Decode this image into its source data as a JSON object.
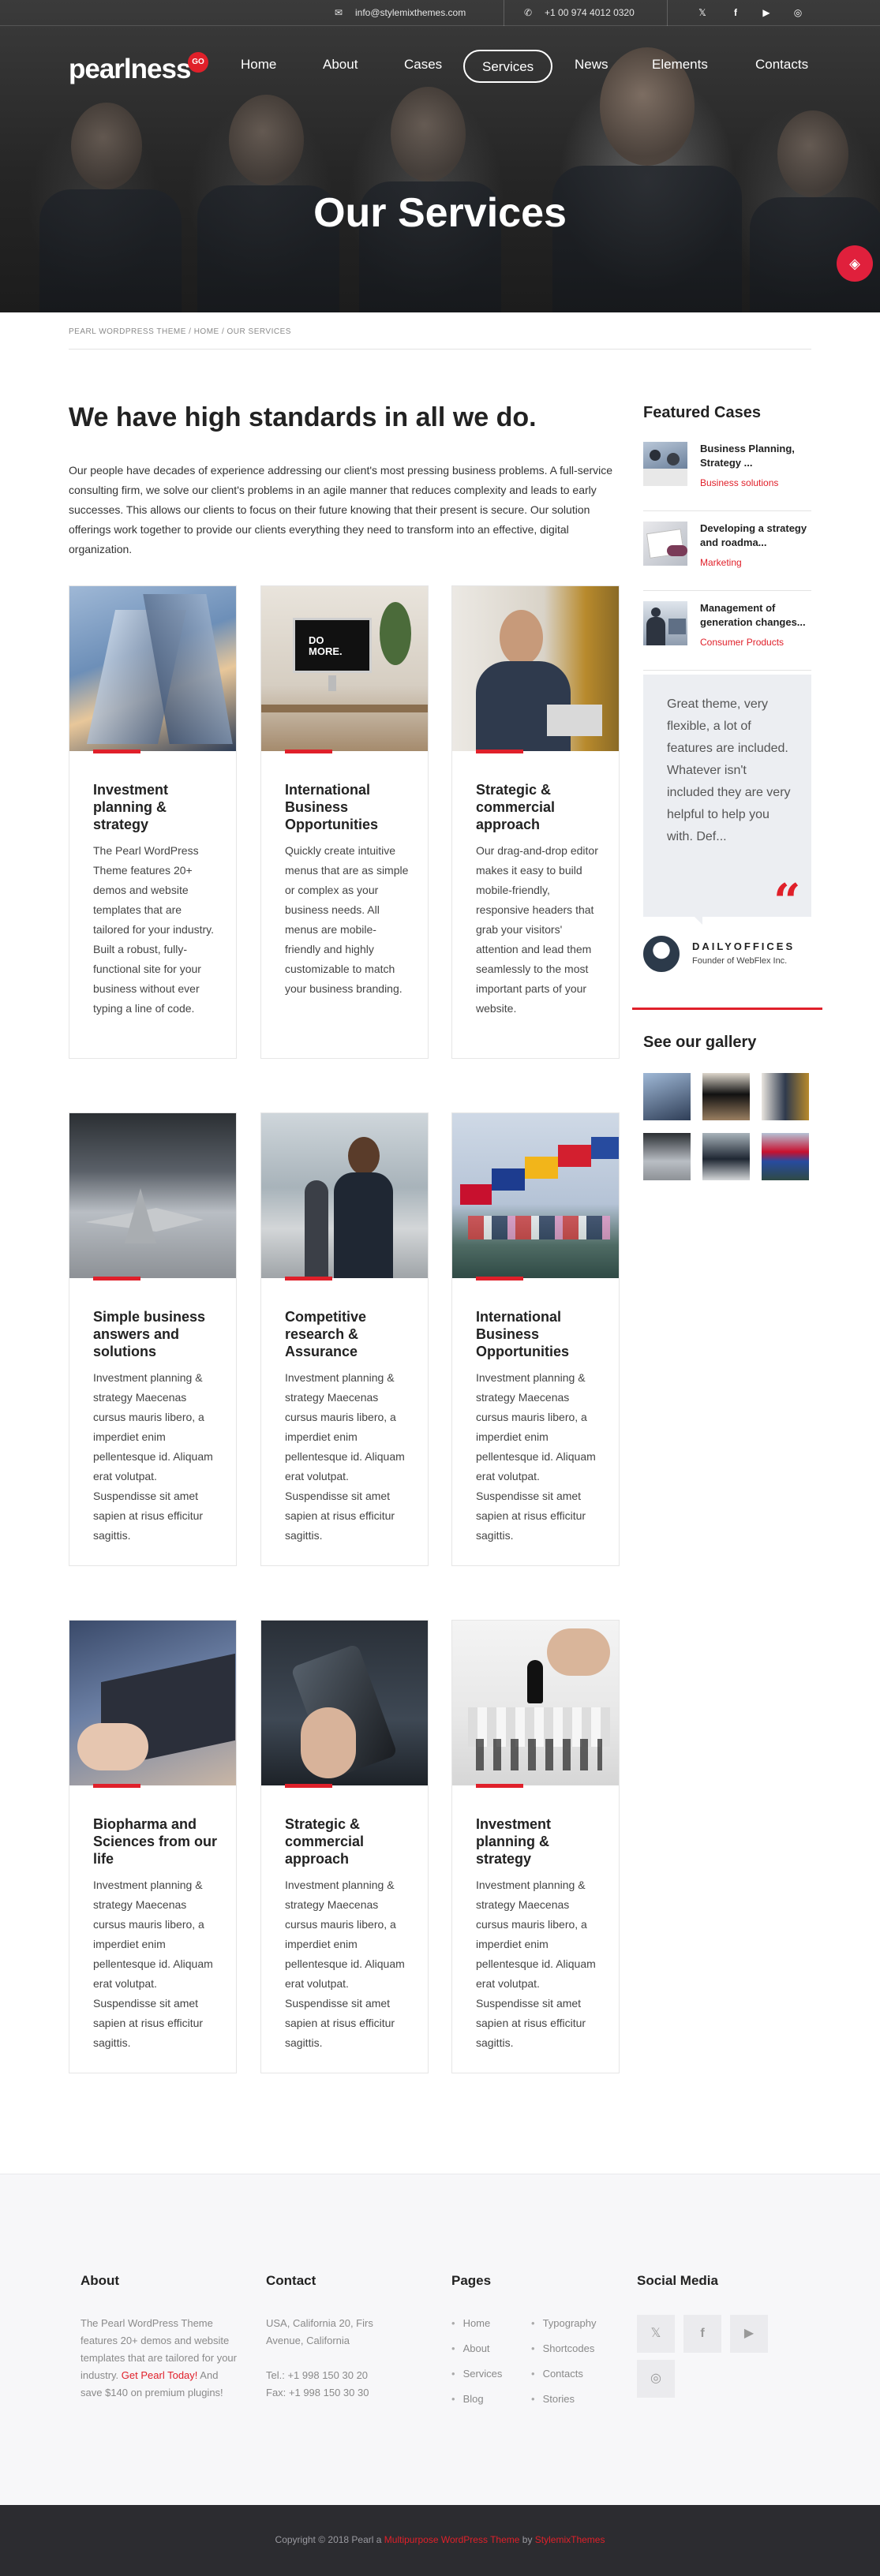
{
  "topbar": {
    "email": "info@stylemixthemes.com",
    "phone": "+1 00 974 4012 0320",
    "social": [
      "twitter-icon",
      "facebook-icon",
      "youtube-icon",
      "instagram-icon"
    ]
  },
  "brand": {
    "logo": "pearlness",
    "badge": "GO"
  },
  "nav": [
    "Home",
    "About",
    "Cases",
    "Services",
    "News",
    "Elements",
    "Contacts"
  ],
  "hero": {
    "title": "Our Services"
  },
  "breadcrumb": "PEARL WORDPRESS THEME / HOME / OUR SERVICES",
  "main": {
    "heading": "We have high standards in all we do.",
    "intro": "Our people have decades of experience addressing our client's most pressing business problems. A full-service consulting firm, we solve our client's problems in an agile manner that reduces complexity and leads to early successes. This allows our clients to focus on their future knowing that their present is secure. Our solution offerings work together to provide our clients everything they need to transform into an effective, digital organization."
  },
  "cards": [
    {
      "title": "Investment planning & strategy",
      "text": "The Pearl WordPress Theme features 20+ demos and website templates that are tailored for your industry. Built a robust, fully-functional site for your business without ever typing a line of code."
    },
    {
      "title": "International Business Opportunities",
      "text": "Quickly create intuitive menus that are as simple or complex as your business needs. All menus are mobile-friendly and highly customizable to match your business branding."
    },
    {
      "title": "Strategic & commercial approach",
      "text": "Our drag-and-drop editor makes it easy to build mobile-friendly, responsive headers that grab your visitors' attention and lead them seamlessly to the most important parts of your website."
    },
    {
      "title": "Simple business answers and solutions",
      "text": "Investment planning & strategy Maecenas cursus mauris libero, a imperdiet enim pellentesque id. Aliquam erat volutpat. Suspendisse sit amet sapien at risus efficitur sagittis."
    },
    {
      "title": "Competitive research & Assurance",
      "text": "Investment planning & strategy Maecenas cursus mauris libero, a imperdiet enim pellentesque id. Aliquam erat volutpat. Suspendisse sit amet sapien at risus efficitur sagittis."
    },
    {
      "title": "International Business Opportunities",
      "text": "Investment planning & strategy Maecenas cursus mauris libero, a imperdiet enim pellentesque id. Aliquam erat volutpat. Suspendisse sit amet sapien at risus efficitur sagittis."
    },
    {
      "title": "Biopharma and Sciences from our life",
      "text": "Investment planning & strategy Maecenas cursus mauris libero, a imperdiet enim pellentesque id. Aliquam erat volutpat. Suspendisse sit amet sapien at risus efficitur sagittis."
    },
    {
      "title": "Strategic & commercial approach",
      "text": "Investment planning & strategy Maecenas cursus mauris libero, a imperdiet enim pellentesque id. Aliquam erat volutpat. Suspendisse sit amet sapien at risus efficitur sagittis."
    },
    {
      "title": "Investment planning & strategy",
      "text": "Investment planning & strategy Maecenas cursus mauris libero, a imperdiet enim pellentesque id. Aliquam erat volutpat. Suspendisse sit amet sapien at risus efficitur sagittis."
    }
  ],
  "sidebar": {
    "featured_heading": "Featured Cases",
    "featured": [
      {
        "title": "Business Planning, Strategy ...",
        "category": "Business solutions"
      },
      {
        "title": "Developing a strategy and roadma...",
        "category": "Marketing"
      },
      {
        "title": "Management of generation changes...",
        "category": "Consumer Products"
      }
    ],
    "quote": "Great theme, very flexible, a lot of features are included. Whatever isn't included they are very helpful to help you with. Def...",
    "quote_mark": "“",
    "quote_author": "DAILYOFFICES",
    "quote_role": "Founder of WebFlex Inc.",
    "gallery_heading": "See our gallery"
  },
  "footer": {
    "about_heading": "About",
    "about_text": "The Pearl WordPress Theme features 20+ demos and website templates that are tailored for your industry.",
    "about_link": "Get Pearl Today!",
    "about_tail": "And save $140 on premium plugins!",
    "contact_heading": "Contact",
    "contact_address": "USA, California 20, Firs Avenue, California",
    "contact_tel": "Tel.: +1 998 150 30 20",
    "contact_fax": "Fax: +1 998 150 30 30",
    "pages_heading": "Pages",
    "pages_col1": [
      "Home",
      "About",
      "Services",
      "Blog"
    ],
    "pages_col2": [
      "Typography",
      "Shortcodes",
      "Contacts",
      "Stories"
    ],
    "social_heading": "Social Media",
    "social": [
      "twitter-icon",
      "facebook-icon",
      "youtube-icon",
      "instagram-icon"
    ]
  },
  "copyright": {
    "prefix": "Copyright © 2018 Pearl a ",
    "link1": "Multipurpose WordPress Theme",
    "middle": " by ",
    "link2": "StylemixThemes"
  },
  "colors": {
    "accent": "#e0202a",
    "hero_dark": "#262626",
    "footer_bg": "#f7f7f9",
    "bottom_bar": "#2c2c30"
  }
}
